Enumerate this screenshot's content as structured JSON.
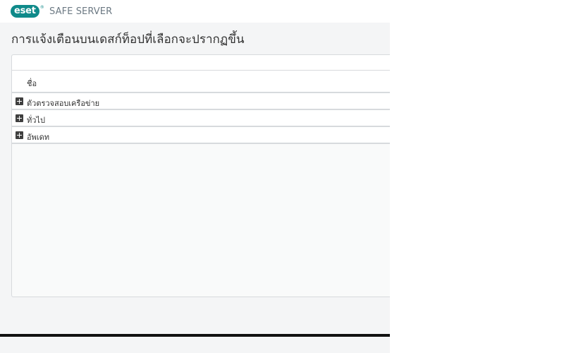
{
  "brand": {
    "logo_text": "eset",
    "registered": "®",
    "product": "SAFE SERVER"
  },
  "page": {
    "title": "การแจ้งเตือนบนเดสก์ท็อปที่เลือกจะปรากฏขึ้น"
  },
  "table": {
    "column_header": "ชื่อ",
    "rows": [
      {
        "label": "ตัวตรวจสอบเครือข่าย",
        "icon": "plus-expand-icon"
      },
      {
        "label": "ทั่วไป",
        "icon": "plus-expand-icon"
      },
      {
        "label": "อัพเดท",
        "icon": "plus-expand-icon"
      }
    ]
  },
  "colors": {
    "brand_teal": "#0f8a8a",
    "background": "#f4f5f6",
    "border": "#d7dadd"
  }
}
